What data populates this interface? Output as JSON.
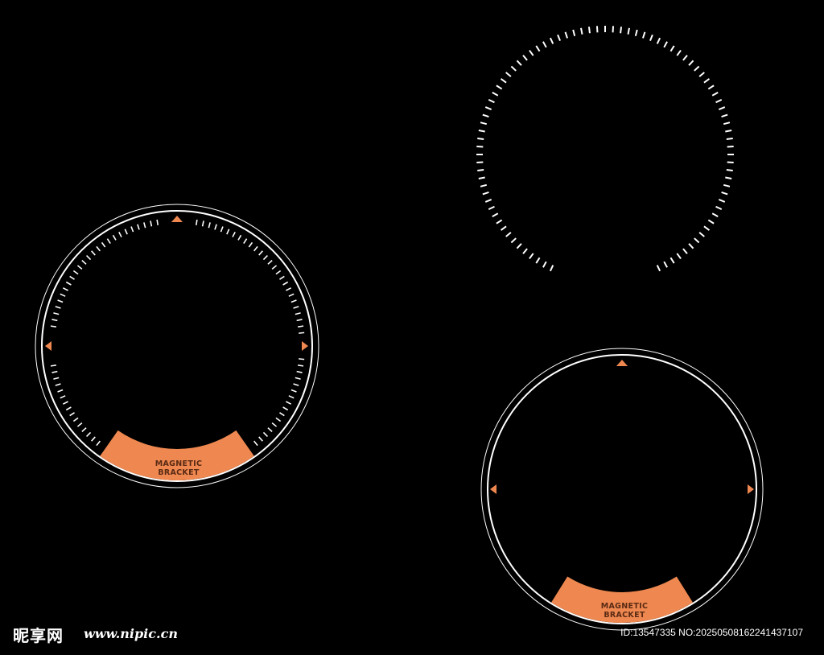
{
  "colors": {
    "background": "#000000",
    "line": "#ffffff",
    "accent": "#ee8850",
    "label_text": "#5a2a14"
  },
  "frames": [
    {
      "name": "frame-left",
      "label": [
        "MAGNETIC",
        "BRACKET"
      ],
      "arrows": [
        "up-triangle-icon",
        "left-triangle-icon",
        "right-triangle-icon"
      ]
    },
    {
      "name": "frame-top-right",
      "style": "dashed-ring"
    },
    {
      "name": "frame-bottom-right",
      "label": [
        "MAGNETIC",
        "BRACKET"
      ],
      "arrows": [
        "up-triangle-icon",
        "left-triangle-icon",
        "right-triangle-icon"
      ]
    }
  ],
  "watermark": {
    "logo": "昵享网",
    "site": "www.nipic.cn",
    "id_text": "ID:13547335 NO:20250508162241437107"
  }
}
